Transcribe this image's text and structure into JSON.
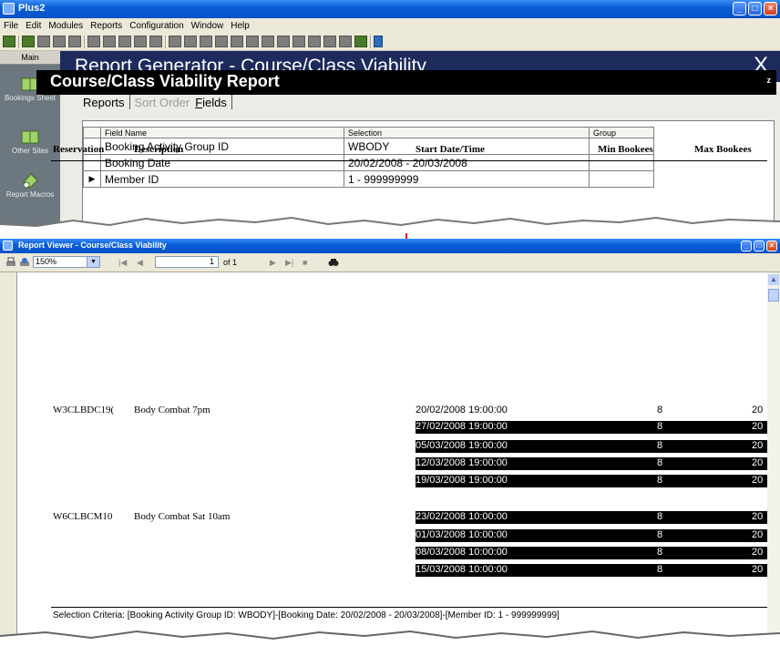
{
  "top_window": {
    "title": "Plus2",
    "menu": [
      "File",
      "Edit",
      "Modules",
      "Reports",
      "Configuration",
      "Window",
      "Help"
    ],
    "nav": {
      "main_label": "Main",
      "items": [
        "Bookings Sheet",
        "Other Sites",
        "Report Macros"
      ]
    },
    "header": {
      "title": "Report Generator - Course/Class Viability",
      "close_label": "X"
    },
    "tabs": {
      "reports": "Reports",
      "sort_order": "Sort Order",
      "fields_prefix": "F",
      "fields_rest": "ields"
    },
    "grid": {
      "headers": [
        "Field Name",
        "Selection",
        "Group"
      ],
      "rows": [
        {
          "field": "Booking Activity Group ID",
          "selection": "WBODY",
          "group": ""
        },
        {
          "field": "Booking Date",
          "selection": "20/02/2008 - 20/03/2008",
          "group": ""
        },
        {
          "field": "Member ID",
          "selection": "1 - 999999999",
          "group": ""
        }
      ]
    }
  },
  "report_viewer": {
    "title": "Report Viewer - Course/Class Viability",
    "toolbar": {
      "zoom": "150%",
      "page_input": "1",
      "page_count": "of 1"
    },
    "report": {
      "title": "Course/Class Viability Report",
      "corner_mark": "z",
      "columns": [
        "Reservation",
        "Description",
        "Start Date/Time",
        "Min Bookees",
        "Max Bookees"
      ],
      "groups": [
        {
          "reservation": "W3CLBDC19(",
          "description": "Body Combat 7pm",
          "rows": [
            {
              "start": "20/02/2008  19:00:00",
              "min": "8",
              "max": "20"
            },
            {
              "start": "27/02/2008  19:00:00",
              "min": "8",
              "max": "20"
            },
            {
              "start": "05/03/2008  19:00:00",
              "min": "8",
              "max": "20"
            },
            {
              "start": "12/03/2008  19:00:00",
              "min": "8",
              "max": "20"
            },
            {
              "start": "19/03/2008  19:00:00",
              "min": "8",
              "max": "20"
            }
          ]
        },
        {
          "reservation": "W6CLBCM10",
          "description": "Body Combat Sat 10am",
          "rows": [
            {
              "start": "23/02/2008  10:00:00",
              "min": "8",
              "max": "20"
            },
            {
              "start": "01/03/2008  10:00:00",
              "min": "8",
              "max": "20"
            },
            {
              "start": "08/03/2008  10:00:00",
              "min": "8",
              "max": "20"
            },
            {
              "start": "15/03/2008  10:00:00",
              "min": "8",
              "max": "20"
            }
          ]
        }
      ],
      "selection_criteria": "Selection Criteria: [Booking Activity Group ID: WBODY]-[Booking Date: 20/02/2008 - 20/03/2008]-[Member ID: 1 - 999999999]"
    }
  },
  "colors": {
    "header_navy": "#1d2a5c",
    "nav_gray": "#6c7780",
    "arrow_red": "#e02020",
    "xp_blue": "#0a5fd8"
  }
}
